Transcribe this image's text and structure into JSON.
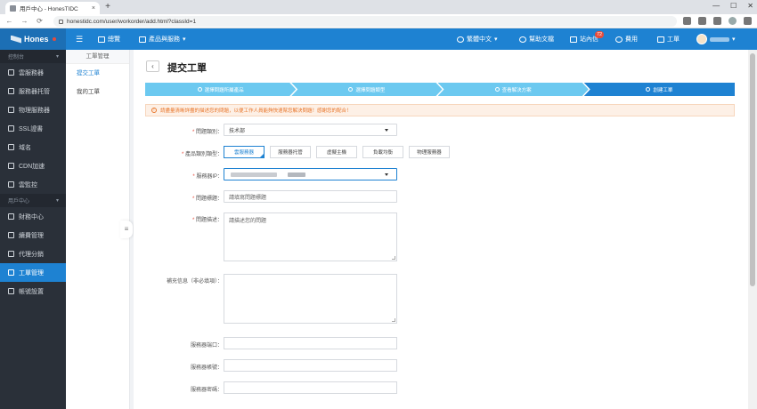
{
  "browser": {
    "tab_title": "用戶中心 - HonesTIDC",
    "tab_close": "×",
    "new_tab": "+",
    "window_controls": [
      "—",
      "☐",
      "✕"
    ],
    "back": "←",
    "forward": "→",
    "reload": "⟳",
    "url": "honestidc.com/user/workorder/add.html?classId=1"
  },
  "header": {
    "logo_text": "Hones",
    "menu_icon": "☰",
    "nav_console": "總覽",
    "nav_products": "產品與服務",
    "nav_products_caret": "▾",
    "lang": "繁體中文",
    "lang_caret": "▾",
    "help": "幫助文檔",
    "messages": "站內信",
    "messages_badge": "72",
    "billing": "費用",
    "tickets": "工單",
    "user_caret": "▾"
  },
  "sidebar": {
    "group1": "控制台",
    "group1_caret": "▾",
    "items1": [
      "雲服務器",
      "服務器托管",
      "物理服務器",
      "SSL證書",
      "域名",
      "CDN加速",
      "雲監控"
    ],
    "group2": "用戶中心",
    "group2_caret": "▾",
    "items2": [
      "財務中心",
      "續費管理",
      "代理分銷",
      "工單管理",
      "帳號設置"
    ]
  },
  "submenu": {
    "title": "工單管理",
    "items": [
      "提交工單",
      "我的工單"
    ]
  },
  "main": {
    "back": "‹",
    "title": "提交工單",
    "steps": [
      "選擇問題所屬產品",
      "選擇問題類型",
      "查看解決方案",
      "創建工單"
    ],
    "notice": "請盡量清晰詳盡的描述您的問題，以便工作人員能夠快速幫您解決問題！感謝您的配合！",
    "notice_icon": "!",
    "form": {
      "category_label": "問題類別：",
      "category_value": "技术部",
      "product_label": "產品類別類型：",
      "product_options": [
        "雲服務器",
        "服務器托管",
        "虛擬主機",
        "負載均衡",
        "物理服務器"
      ],
      "server_ip_label": "服務器IP：",
      "subject_label": "問題標題：",
      "subject_placeholder": "請填寫問題標題",
      "desc_label": "問題描述：",
      "desc_placeholder": "請描述您的問題",
      "extra_label": "補充信息（非必填項）：",
      "port_label": "服務器端口：",
      "account_label": "服務器帳號：",
      "password_label": "服務器密碼："
    }
  },
  "colors": {
    "primary": "#1e82d2",
    "sidebar_bg": "#2a3039",
    "step_done": "#6cc9f0",
    "step_active": "#1e82d2",
    "warning": "#e8762b",
    "required": "#e74c3c"
  }
}
